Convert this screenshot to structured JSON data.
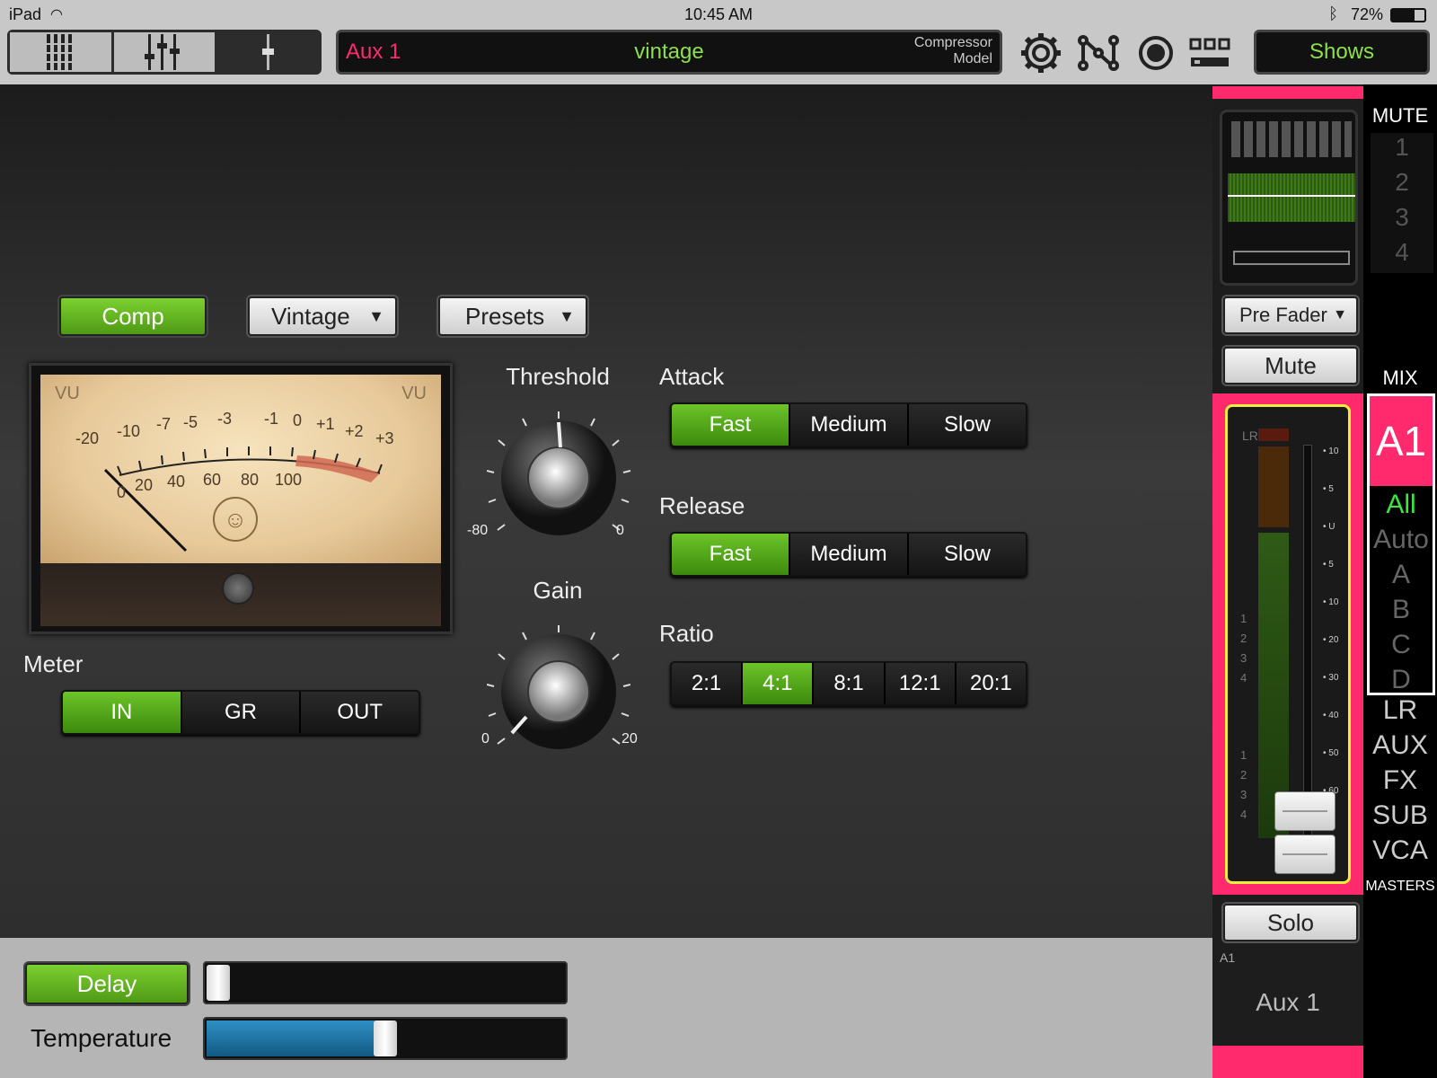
{
  "status": {
    "device": "iPad",
    "time": "10:45 AM",
    "battery": "72%"
  },
  "toolbar": {
    "channel": "Aux 1",
    "preset_name": "vintage",
    "model_line1": "Compressor",
    "model_line2": "Model",
    "shows_label": "Shows",
    "icons": [
      "mixer-overview-icon",
      "fader-bank-icon",
      "single-channel-icon",
      "settings-gear-icon",
      "routing-icon",
      "record-icon",
      "scenes-grid-icon"
    ]
  },
  "plugin": {
    "comp_label": "Comp",
    "model_select": "Vintage",
    "presets_label": "Presets",
    "vu": {
      "label_left": "VU",
      "label_right": "VU",
      "top_scale": [
        "-20",
        "-10",
        "-7",
        "-5",
        "-3",
        "-1",
        "0",
        "+1",
        "+2",
        "+3"
      ],
      "bottom_scale": [
        "0",
        "20",
        "40",
        "60",
        "80",
        "100"
      ]
    },
    "meter": {
      "label": "Meter",
      "options": [
        "IN",
        "GR",
        "OUT"
      ],
      "selected": "IN"
    },
    "threshold": {
      "label": "Threshold",
      "min": "-80",
      "max": "0"
    },
    "gain": {
      "label": "Gain",
      "min": "0",
      "max": "20"
    },
    "attack": {
      "label": "Attack",
      "options": [
        "Fast",
        "Medium",
        "Slow"
      ],
      "selected": "Fast"
    },
    "release": {
      "label": "Release",
      "options": [
        "Fast",
        "Medium",
        "Slow"
      ],
      "selected": "Fast"
    },
    "ratio": {
      "label": "Ratio",
      "options": [
        "2:1",
        "4:1",
        "8:1",
        "12:1",
        "20:1"
      ],
      "selected": "4:1"
    }
  },
  "bottom": {
    "delay_label": "Delay",
    "temperature_label": "Temperature",
    "delay_fraction": 0.0,
    "temperature_fraction": 0.5
  },
  "strip": {
    "send_select": "Pre Fader",
    "mute_label": "Mute",
    "solo_label": "Solo",
    "meter_label": "LR",
    "scale": [
      "10",
      "5",
      "U",
      "5",
      "10",
      "20",
      "30",
      "40",
      "50",
      "60",
      "∞"
    ],
    "side_numbers_a": [
      "1",
      "2",
      "3",
      "4"
    ],
    "side_numbers_b": [
      "1",
      "2",
      "3",
      "4"
    ],
    "channel_tag": "A1",
    "channel_name": "Aux 1",
    "accent": "#ff2a6d",
    "fader_outline": "#f2ec3a"
  },
  "masters": {
    "mute_title": "MUTE",
    "mute_groups": [
      "1",
      "2",
      "3",
      "4"
    ],
    "mix_title": "MIX",
    "mix_current": "A1",
    "mix_items": [
      "All",
      "Auto",
      "A",
      "B",
      "C",
      "D"
    ],
    "master_items": [
      "LR",
      "AUX",
      "FX",
      "SUB",
      "VCA"
    ],
    "masters_title": "MASTERS"
  }
}
